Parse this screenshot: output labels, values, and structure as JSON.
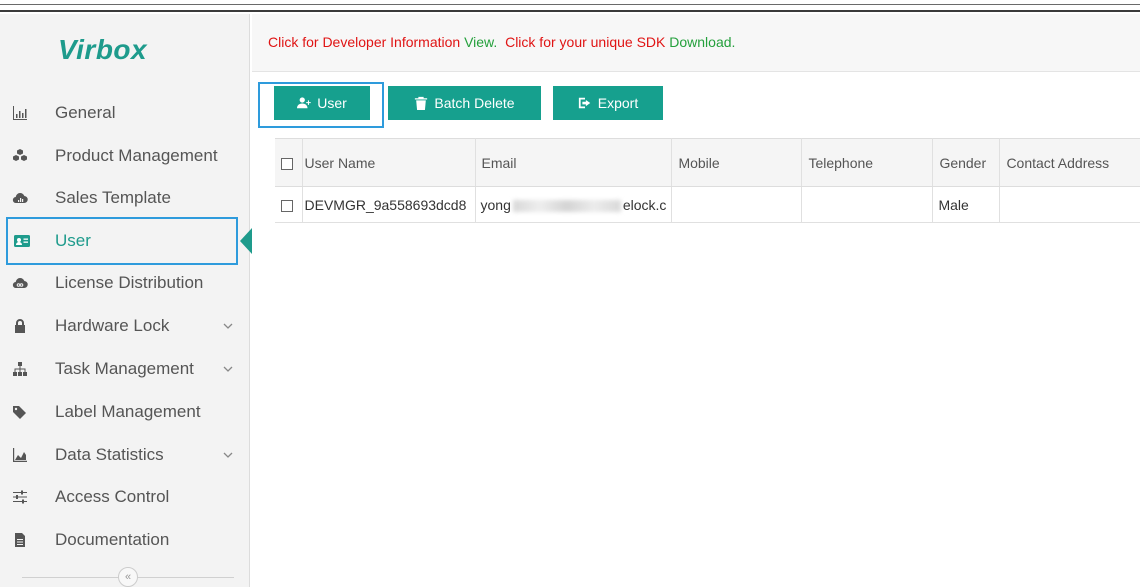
{
  "app": {
    "logo": "Virbox"
  },
  "info_bar": {
    "part1": "Click for Developer Information",
    "link1": "View.",
    "part2": "Click for your unique SDK",
    "link2": "Download."
  },
  "sidebar": {
    "items": [
      {
        "label": "General",
        "icon": "bar-chart-icon"
      },
      {
        "label": "Product Management",
        "icon": "cubes-icon"
      },
      {
        "label": "Sales Template",
        "icon": "cloud-chart-icon"
      },
      {
        "label": "User",
        "icon": "user-card-icon",
        "active": true
      },
      {
        "label": "License Distribution",
        "icon": "cloud-icon"
      },
      {
        "label": "Hardware Lock",
        "icon": "lock-icon",
        "expandable": true
      },
      {
        "label": "Task Management",
        "icon": "sitemap-icon",
        "expandable": true
      },
      {
        "label": "Label Management",
        "icon": "tags-icon"
      },
      {
        "label": "Data Statistics",
        "icon": "area-chart-icon",
        "expandable": true
      },
      {
        "label": "Access Control",
        "icon": "sliders-icon"
      },
      {
        "label": "Documentation",
        "icon": "file-icon"
      }
    ],
    "collapse_glyph": "«"
  },
  "toolbar": {
    "user_label": "User",
    "batch_delete_label": "Batch Delete",
    "export_label": "Export"
  },
  "table": {
    "columns": [
      "User Name",
      "Email",
      "Mobile",
      "Telephone",
      "Gender",
      "Contact Address"
    ],
    "rows": [
      {
        "user_name": "DEVMGR_9a558693dcd8",
        "email_prefix": "yong",
        "email_suffix": "elock.c",
        "mobile": "",
        "telephone": "",
        "gender": "Male",
        "contact_address": ""
      }
    ]
  },
  "colors": {
    "accent": "#16a08e",
    "highlight_border": "#2e9bdc",
    "info_red": "#e01414",
    "info_green": "#24a03c"
  }
}
